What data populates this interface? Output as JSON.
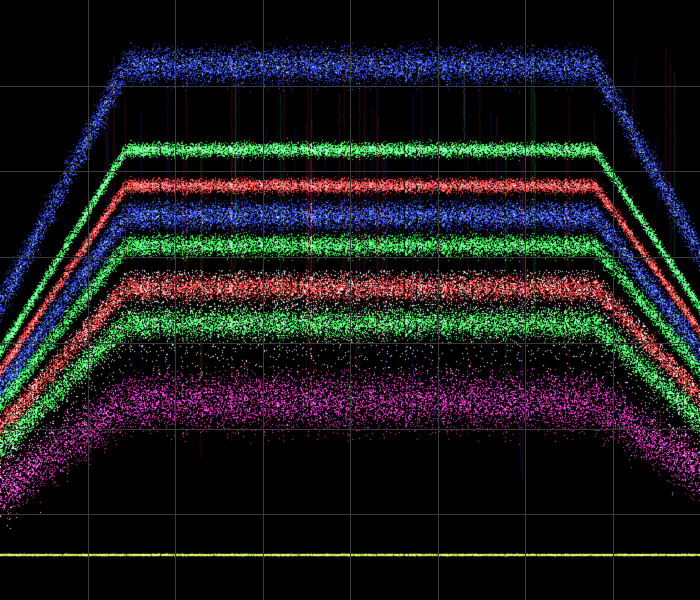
{
  "scope": {
    "type": "RGB parade / vectorscope-style waveform monitor",
    "background_color": "#000000",
    "graticule_color": "#3a3a3a",
    "graticule": {
      "vertical_divisions": 8,
      "horizontal_divisions": 7,
      "visible": true
    },
    "channel_colors": {
      "red": "#ff2a2a",
      "green": "#2aff3a",
      "blue": "#2a3aff",
      "magenta": "#ff2aa0"
    },
    "bands": [
      {
        "channel": "blue",
        "level_from_top": 0.11,
        "spread": 0.05
      },
      {
        "channel": "green",
        "level_from_top": 0.25,
        "spread": 0.02
      },
      {
        "channel": "red",
        "level_from_top": 0.31,
        "spread": 0.02
      },
      {
        "channel": "blue",
        "level_from_top": 0.36,
        "spread": 0.04
      },
      {
        "channel": "green",
        "level_from_top": 0.41,
        "spread": 0.03
      },
      {
        "channel": "red",
        "level_from_top": 0.48,
        "spread": 0.035
      },
      {
        "channel": "green",
        "level_from_top": 0.54,
        "spread": 0.04
      },
      {
        "channel": "magenta",
        "level_from_top": 0.67,
        "spread": 0.08
      }
    ],
    "baseline_level_from_top": 0.925
  }
}
